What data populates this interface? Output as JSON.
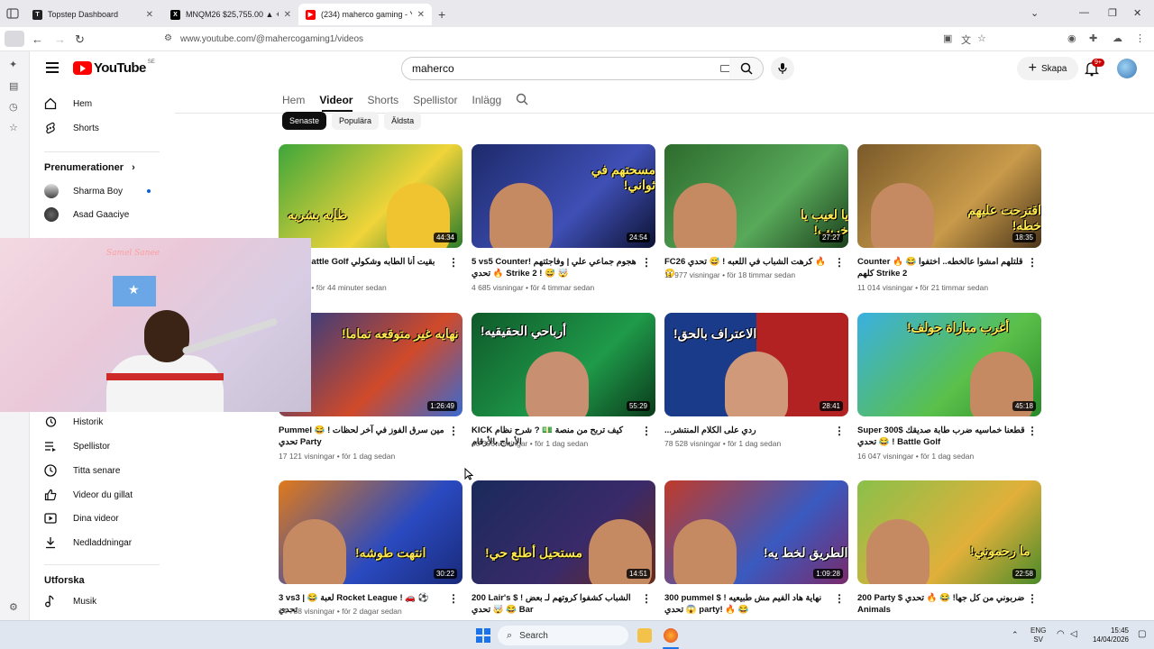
{
  "browser": {
    "tabs": [
      {
        "title": "Topstep Dashboard",
        "favicon": "T"
      },
      {
        "title": "MNQM26 $25,755.00 ▲ +0.83%",
        "favicon": "X"
      },
      {
        "title": "(234) maherco gaming - YouTube",
        "favicon": "▶"
      }
    ],
    "url": "www.youtube.com/@mahercogaming1/videos"
  },
  "yt": {
    "logo_word": "YouTube",
    "country": "SE",
    "search_value": "maherco",
    "create_label": "Skapa",
    "notif_count": "9+"
  },
  "sidenav": {
    "home": "Hem",
    "shorts": "Shorts",
    "subs_heading": "Prenumerationer",
    "subs": [
      {
        "name": "Sharma Boy"
      },
      {
        "name": "Asad Gaaciye"
      }
    ],
    "you_items": [
      {
        "label": "Historik"
      },
      {
        "label": "Spellistor"
      },
      {
        "label": "Titta senare"
      },
      {
        "label": "Videor du gillat"
      },
      {
        "label": "Dina videor"
      },
      {
        "label": "Nedladdningar"
      }
    ],
    "explore_heading": "Utforska",
    "music": "Musik"
  },
  "channel_tabs": [
    "Hem",
    "Videor",
    "Shorts",
    "Spellistor",
    "Inlägg"
  ],
  "chips": [
    "Senaste",
    "Populära",
    "Äldsta"
  ],
  "videos": [
    {
      "title": "Super Battle Golf بقيت أنا الطابه وشكولي",
      "meta": "för 44 minuter sedan",
      "views": "visningar",
      "duration": "44:34",
      "overlay": "طابه بشريه"
    },
    {
      "title": "5 vs5 Counterهجوم جماعي علي | وفاجئتهم ! 🔥 تحدي Strike 2 ! 😅 🤯",
      "meta": "för 4 timmar sedan",
      "views": "4 685 visningar",
      "duration": "24:54",
      "overlay": "مسحتهم في ثواني!"
    },
    {
      "title": "FC26 كرهت الشباب في اللعبه ! 😅 تحدي 🔥 🙄",
      "meta": "för 18 timmar sedan",
      "views": "11 977 visningar",
      "duration": "27:27",
      "overlay": "يا لعيب يا خريب!"
    },
    {
      "title": "Counter 🔥 😂 قلتلهم امشوا عالخطه.. اختفوا كلهم Strike 2",
      "meta": "för 21 timmar sedan",
      "views": "11 014 visningar",
      "duration": "18:35",
      "overlay": "اقترحت عليهم خطه!"
    },
    {
      "title": "Pummel مين سرق الفوز في آخر لحظات ! 😂 تحدي Party",
      "meta": "för 1 dag sedan",
      "views": "17 121 visningar",
      "duration": "1:26:49",
      "overlay": "نهايه غير متوقعه تماما!"
    },
    {
      "title": "KICK كيف تربح من منصة 💵 ? شرح نظام الأرباح بالأرقام",
      "meta": "för 1 dag sedan",
      "views": "40 396 visningar",
      "duration": "55:29",
      "overlay": "أرباحي الحقيقيه!"
    },
    {
      "title": "...ردي على الكلام المنتشر",
      "meta": "för 1 dag sedan",
      "views": "78 528 visningar",
      "duration": "28:41",
      "overlay": "الاعتراف بالحق!"
    },
    {
      "title": "Super 300$ قطعنا خماسيه ضرب طابة صديقك ! 😂 تحدي Battle Golf",
      "meta": "för 1 dag sedan",
      "views": "16 047 visningar",
      "duration": "45:18",
      "overlay": "أغرب مباراة جولف!"
    },
    {
      "title": "3 vs3 | 😂 لعبة Rocket League ! 🚗 ⚽ تحدي",
      "meta": "för 2 dagar sedan",
      "views": "14 788 visningar",
      "duration": "30:22",
      "overlay": "انتهت طوشه!"
    },
    {
      "title": "200 Lair's $ الشباب كشفوا كروتهم لـ بعض ! 😂 🤯 تحدي Bar",
      "meta": "",
      "views": "",
      "duration": "14:51",
      "overlay": "مستحيل أطلع حي!"
    },
    {
      "title": "300 pummel $ نهاية هاد الفيم مش طبيعيه ! 😱 تحدي party! 🔥 😂",
      "meta": "",
      "views": "",
      "duration": "1:09:28",
      "overlay": "الطريق لخط يه!"
    },
    {
      "title": "200 Party $ ضربوني من كل جها! 😂 🔥 تحدي Animals",
      "meta": "",
      "views": "",
      "duration": "22:58",
      "overlay": "ما رحموني!"
    }
  ],
  "webcam": {
    "neon": "Samel Sanee"
  },
  "taskbar": {
    "search_label": "Search",
    "lang": "ENG",
    "lang2": "SV",
    "time": "15:45",
    "date": "14/04/2026"
  },
  "colors": {
    "accent_red": "#ff0000",
    "link_blue": "#065fd4"
  }
}
